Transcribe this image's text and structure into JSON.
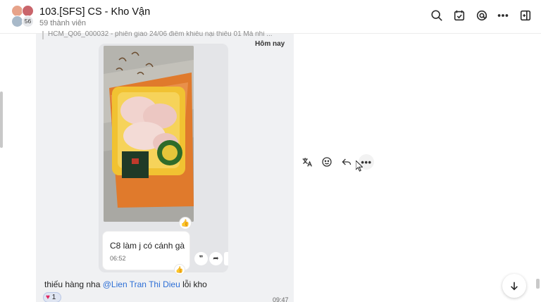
{
  "header": {
    "title": "103.[SFS] CS - Kho Vận",
    "subtitle": "59 thành viên",
    "avatar_count": "56",
    "icons": [
      "search-icon",
      "calendar-check-icon",
      "threads-icon",
      "more-icon",
      "sidebar-toggle-icon"
    ]
  },
  "chat": {
    "quoted_text": "HCM_Q06_000032 - phiên giao 24/06 điểm khiếu nại thiếu 01 Má nhi ...",
    "day_label": "Hôm nay",
    "message": {
      "text": "C8 làm j có cánh gà",
      "time": "06:52"
    },
    "mini_actions": [
      "quote-icon",
      "forward-icon",
      "more-icon"
    ],
    "line_message": {
      "prefix": "thiếu hàng nha ",
      "mention": "@Lien Tran Thi Dieu",
      "suffix": " lỗi kho",
      "time": "09:47"
    },
    "reaction": {
      "emoji": "♥",
      "count": "1"
    }
  },
  "hover_actions": [
    "translate-icon",
    "emoji-icon",
    "reply-icon",
    "more-icon"
  ],
  "colors": {
    "mention": "#2d6fd6",
    "chat_bg": "#f0f1f3",
    "heart": "#e0245e"
  }
}
